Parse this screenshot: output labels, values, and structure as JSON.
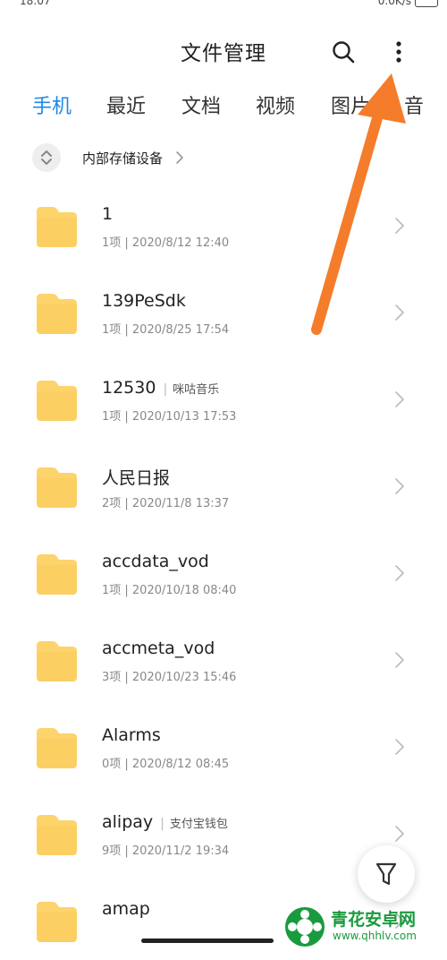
{
  "status_bar": {
    "time": "18:07",
    "network": "0.0K/s"
  },
  "header": {
    "title": "文件管理",
    "search_icon": "search-icon",
    "more_icon": "more-vertical-icon"
  },
  "tabs": [
    {
      "label": "手机",
      "active": true
    },
    {
      "label": "最近"
    },
    {
      "label": "文档"
    },
    {
      "label": "视频"
    },
    {
      "label": "图片"
    },
    {
      "label": "音"
    }
  ],
  "breadcrumb": {
    "storage_label": "内部存储设备"
  },
  "files": [
    {
      "name": "1",
      "app": "",
      "meta": "1项 | 2020/8/12 12:40"
    },
    {
      "name": "139PeSdk",
      "app": "",
      "meta": "1项 | 2020/8/25 17:54"
    },
    {
      "name": "12530",
      "app": "咪咕音乐",
      "meta": "1项 | 2020/10/13 17:53"
    },
    {
      "name": "人民日报",
      "app": "",
      "meta": "2项 | 2020/11/8 13:37"
    },
    {
      "name": "accdata_vod",
      "app": "",
      "meta": "1项 | 2020/10/18 08:40"
    },
    {
      "name": "accmeta_vod",
      "app": "",
      "meta": "3项 | 2020/10/23 15:46"
    },
    {
      "name": "Alarms",
      "app": "",
      "meta": "0项 | 2020/8/12 08:45"
    },
    {
      "name": "alipay",
      "app": "支付宝钱包",
      "meta": "9项 | 2020/11/2 19:34"
    },
    {
      "name": "amap",
      "app": "",
      "meta": ""
    }
  ],
  "watermark": {
    "name": "青花安卓网",
    "url": "www.qhhlv.com"
  },
  "colors": {
    "accent": "#1e88e5",
    "folder": "#fdd36b",
    "arrow": "#f57c2b",
    "watermark": "#1a9a3f"
  }
}
